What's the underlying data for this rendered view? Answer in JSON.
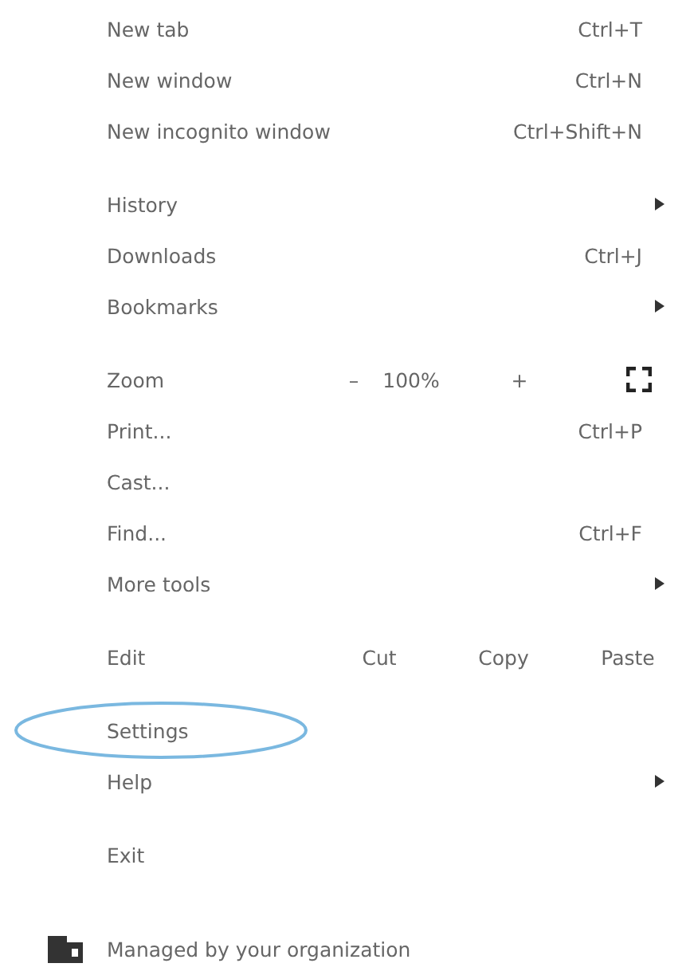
{
  "groups": [
    {
      "items": [
        {
          "kind": "shortcut",
          "label": "New tab",
          "shortcut": "Ctrl+T",
          "circled": false
        },
        {
          "kind": "shortcut",
          "label": "New window",
          "shortcut": "Ctrl+N",
          "circled": false
        },
        {
          "kind": "shortcut",
          "label": "New incognito window",
          "shortcut": "Ctrl+Shift+N",
          "circled": false
        }
      ]
    },
    {
      "items": [
        {
          "kind": "submenu",
          "label": "History",
          "circled": false
        },
        {
          "kind": "shortcut",
          "label": "Downloads",
          "shortcut": "Ctrl+J",
          "circled": false
        },
        {
          "kind": "submenu",
          "label": "Bookmarks",
          "circled": false
        }
      ]
    },
    {
      "items": [
        {
          "kind": "zoom",
          "label": "Zoom",
          "minus": "–",
          "value": "100%",
          "plus": "+",
          "circled": false
        },
        {
          "kind": "shortcut",
          "label": "Print...",
          "shortcut": "Ctrl+P",
          "circled": false
        },
        {
          "kind": "plain",
          "label": "Cast...",
          "circled": false
        },
        {
          "kind": "shortcut",
          "label": "Find...",
          "shortcut": "Ctrl+F",
          "circled": false
        },
        {
          "kind": "submenu",
          "label": "More tools",
          "circled": false
        }
      ]
    },
    {
      "items": [
        {
          "kind": "edit",
          "label": "Edit",
          "actions": [
            "Cut",
            "Copy",
            "Paste"
          ],
          "circled": false
        }
      ]
    },
    {
      "items": [
        {
          "kind": "plain",
          "label": "Settings",
          "circled": true
        },
        {
          "kind": "submenu",
          "label": "Help",
          "circled": false
        }
      ]
    },
    {
      "items": [
        {
          "kind": "plain",
          "label": "Exit",
          "circled": false
        }
      ]
    }
  ],
  "footer": {
    "text": "Managed by your organization"
  }
}
